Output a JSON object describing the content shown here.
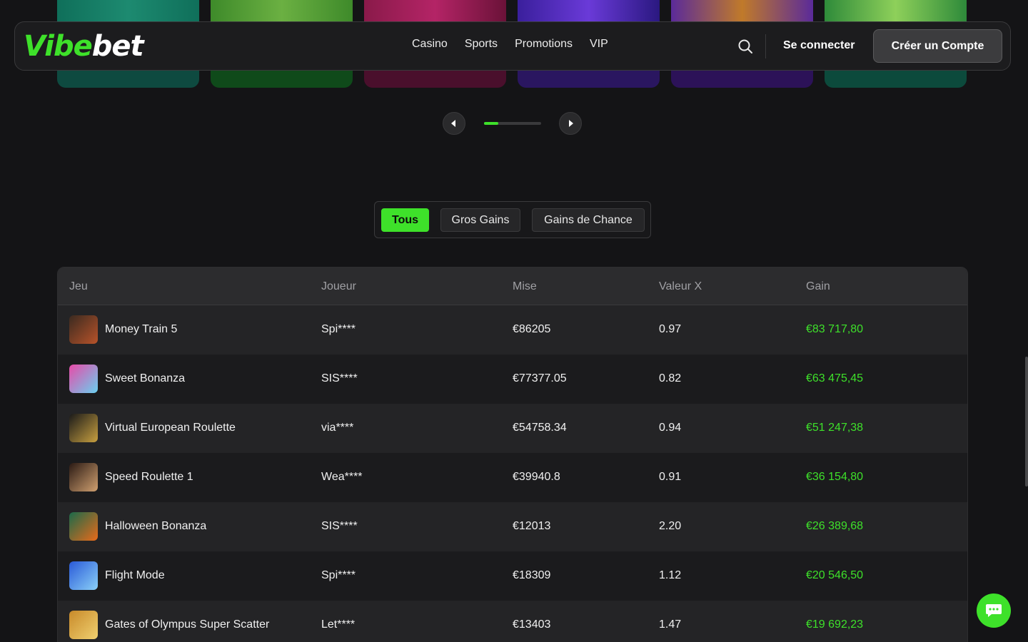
{
  "brand": {
    "logo_part1": "Vibe",
    "logo_part2": "bet",
    "accent": "#3ee12a"
  },
  "nav": {
    "items": [
      {
        "label": "Casino"
      },
      {
        "label": "Sports"
      },
      {
        "label": "Promotions"
      },
      {
        "label": "VIP"
      }
    ]
  },
  "header": {
    "login_label": "Se connecter",
    "signup_label": "Créer un Compte",
    "search_icon": "search-icon"
  },
  "carousel": {
    "progress": 0.25
  },
  "filters": {
    "tabs": [
      {
        "label": "Tous",
        "active": true
      },
      {
        "label": "Gros Gains",
        "active": false
      },
      {
        "label": "Gains de Chance",
        "active": false
      }
    ]
  },
  "table": {
    "columns": [
      "Jeu",
      "Joueur",
      "Mise",
      "Valeur X",
      "Gain"
    ],
    "rows": [
      {
        "game": "Money Train 5",
        "player": "Spi****",
        "bet": "€86205",
        "multiplier": "0.97",
        "win": "€83 717,80"
      },
      {
        "game": "Sweet Bonanza",
        "player": "SIS****",
        "bet": "€77377.05",
        "multiplier": "0.82",
        "win": "€63 475,45"
      },
      {
        "game": "Virtual European Roulette",
        "player": "via****",
        "bet": "€54758.34",
        "multiplier": "0.94",
        "win": "€51 247,38"
      },
      {
        "game": "Speed Roulette 1",
        "player": "Wea****",
        "bet": "€39940.8",
        "multiplier": "0.91",
        "win": "€36 154,80"
      },
      {
        "game": "Halloween Bonanza",
        "player": "SIS****",
        "bet": "€12013",
        "multiplier": "2.20",
        "win": "€26 389,68"
      },
      {
        "game": "Flight Mode",
        "player": "Spi****",
        "bet": "€18309",
        "multiplier": "1.12",
        "win": "€20 546,50"
      },
      {
        "game": "Gates of Olympus Super Scatter",
        "player": "Let****",
        "bet": "€13403",
        "multiplier": "1.47",
        "win": "€19 692,23"
      }
    ]
  },
  "chat": {
    "icon": "chat-icon"
  }
}
